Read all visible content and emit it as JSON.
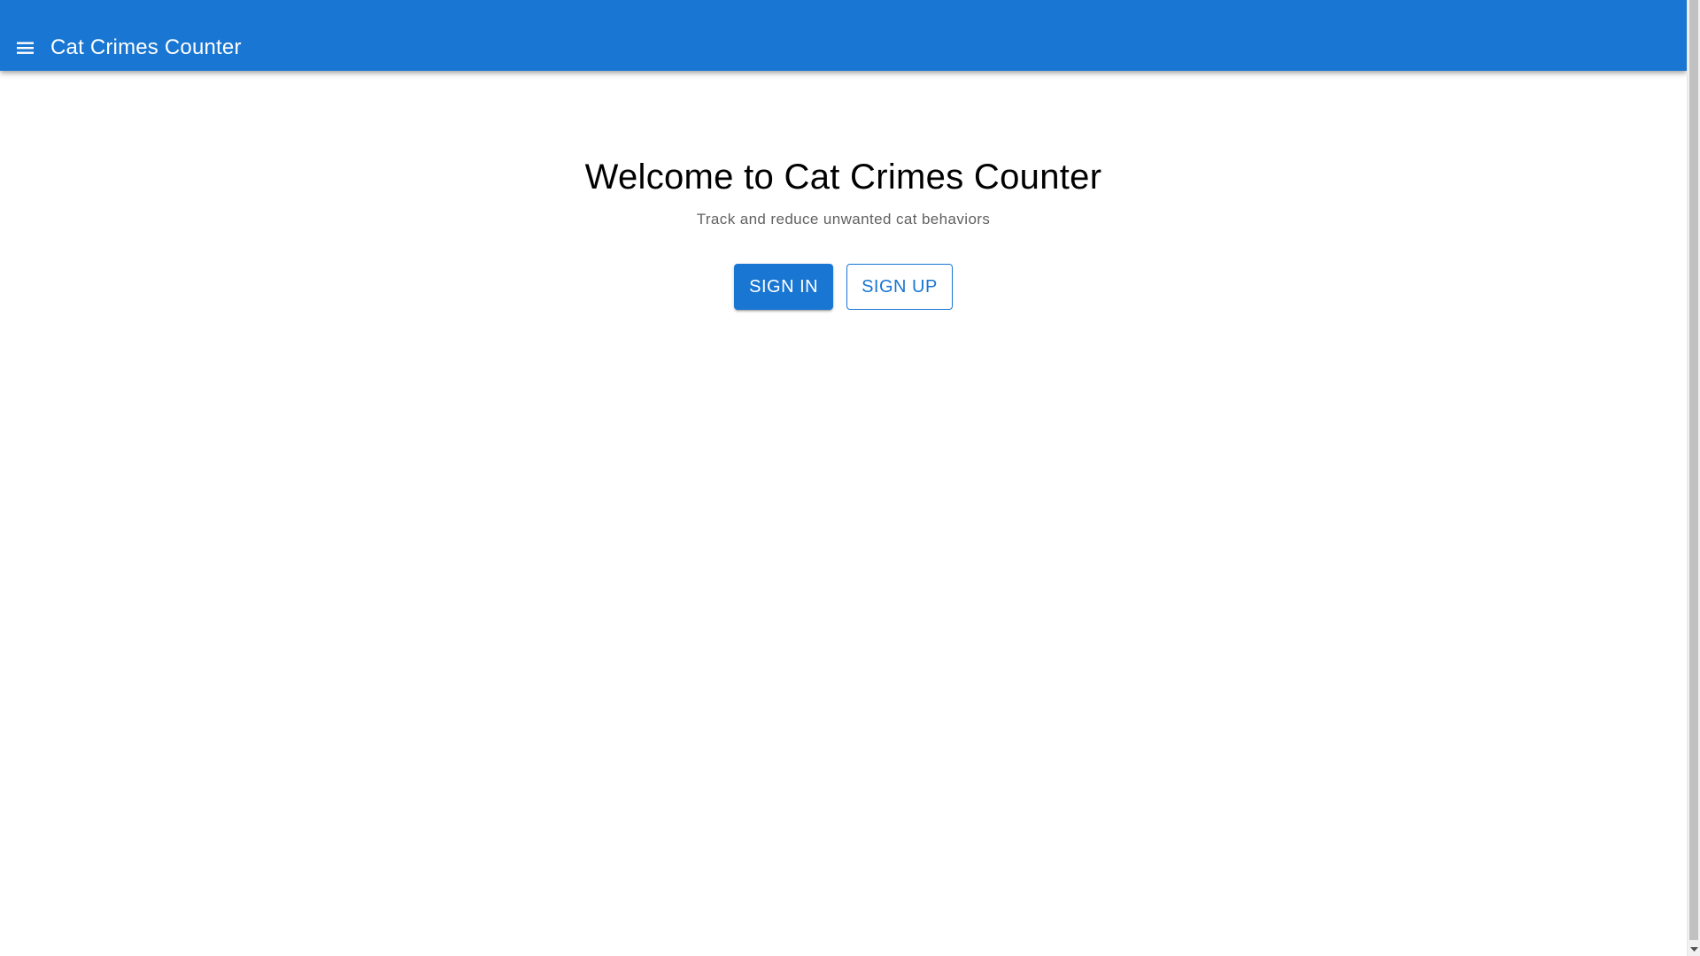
{
  "app": {
    "title": "Cat Crimes Counter",
    "menu_icon": "menu-icon"
  },
  "hero": {
    "title": "Welcome to Cat Crimes Counter",
    "subtitle": "Track and reduce unwanted cat behaviors"
  },
  "actions": {
    "sign_in_label": "SIGN IN",
    "sign_up_label": "SIGN UP"
  },
  "colors": {
    "primary": "#1976d2",
    "on_primary": "#ffffff",
    "text_primary": "#000000",
    "text_secondary": "#616161",
    "background": "#ffffff"
  }
}
